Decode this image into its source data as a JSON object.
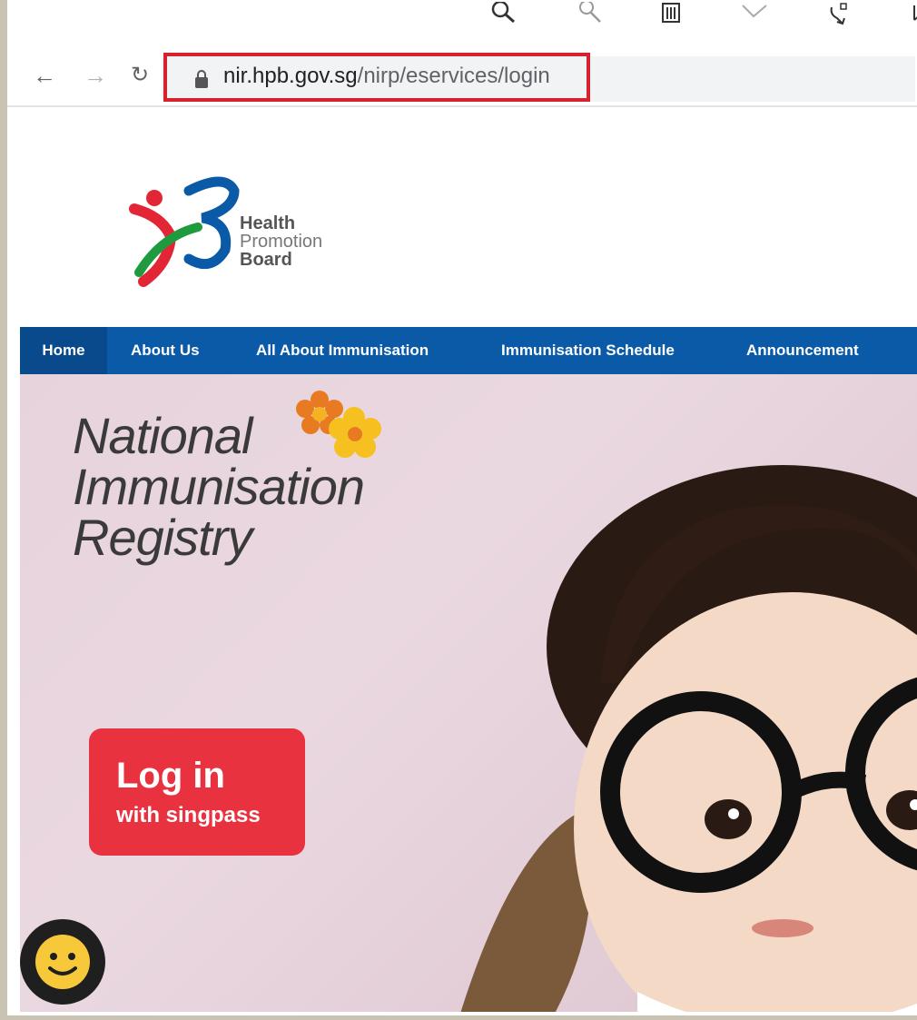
{
  "browser": {
    "address_url_domain": "nir.hpb.gov.sg",
    "address_url_path": "/nirp/eservices/login",
    "nav_icons": [
      "back-arrow-icon",
      "forward-arrow-icon",
      "reload-icon",
      "lock-icon"
    ],
    "toolbar_icons": [
      "zoom-in-icon",
      "zoom-out-icon",
      "reader-icon",
      "favorite-icon",
      "share-icon",
      "open-icon"
    ]
  },
  "site": {
    "logo_lines": [
      "Health",
      "Promotion",
      "Board"
    ],
    "menu": [
      "Home",
      "About Us",
      "All About Immunisation",
      "Immunisation Schedule",
      "Announcement"
    ],
    "hero_title": [
      "National",
      "Immunisation",
      "Registry"
    ],
    "login_main": "Log in",
    "login_sub": "with singpass",
    "colors": {
      "menu_bg": "#0a5aa8",
      "login_bg": "#e8323f",
      "highlight_border": "#d6222e"
    }
  }
}
